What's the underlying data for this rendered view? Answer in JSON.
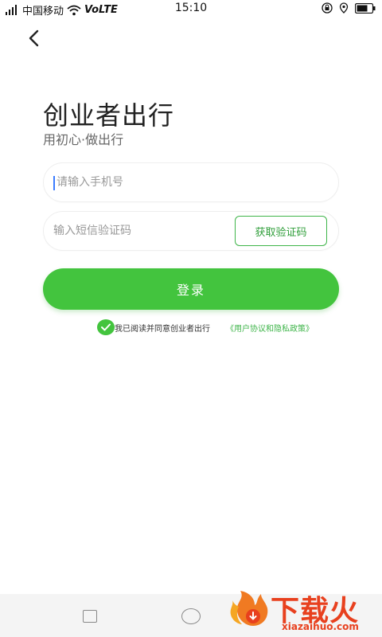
{
  "status_bar": {
    "carrier": "中国移动",
    "network": "VoLTE",
    "time": "15:10"
  },
  "header": {
    "back_icon": "chevron-left-icon"
  },
  "title": "创业者出行",
  "subtitle": "用初心·做出行",
  "phone_input": {
    "placeholder": "请输入手机号",
    "value": ""
  },
  "code_input": {
    "placeholder": "输入短信验证码",
    "value": ""
  },
  "get_code_label": "获取验证码",
  "login_label": "登录",
  "agreement": {
    "checked": true,
    "text": "我已阅读并同意创业者出行",
    "link": "《用户协议和隐私政策》"
  },
  "watermark": {
    "title": "下载火",
    "subtitle": "xiazaihuo.com"
  },
  "colors": {
    "accent": "#43c43e",
    "link": "#3fb54a",
    "watermark": "#e8401e"
  }
}
